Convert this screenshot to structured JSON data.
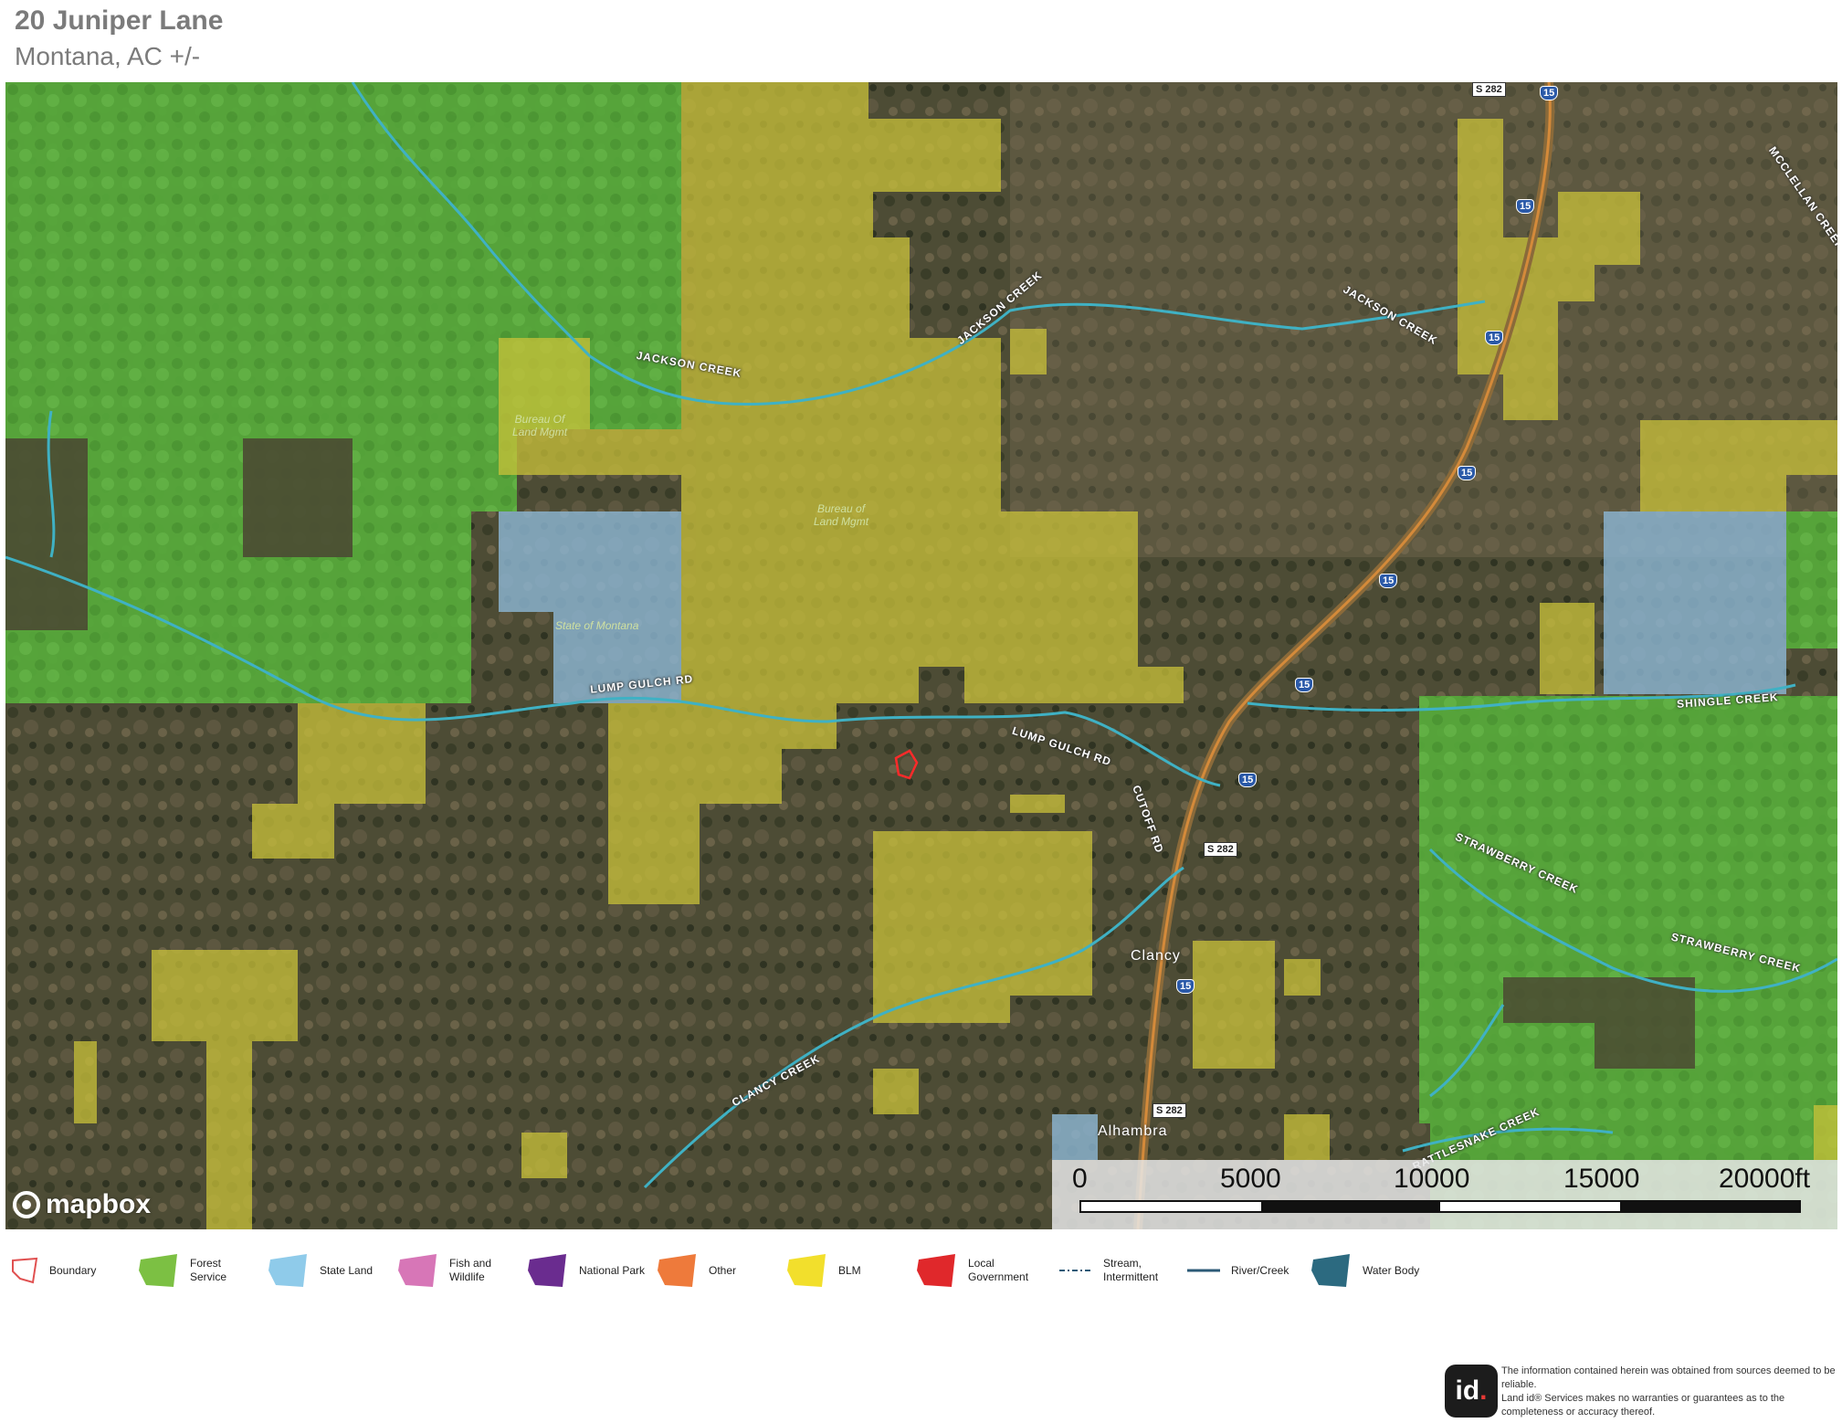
{
  "header": {
    "title": "20 Juniper Lane",
    "subtitle": "Montana,  AC +/-"
  },
  "colors": {
    "forest_service": "#56a83a",
    "blm": "#c9c13a",
    "state_land": "#8db8d6",
    "boundary": "#ff2a2a",
    "river": "#3fb1c4"
  },
  "map": {
    "labels": {
      "jackson_creek_1": "JACKSON CREEK",
      "jackson_creek_2": "JACKSON CREEK",
      "jackson_creek_3": "JACKSON CREEK",
      "mcclellan": "MCCLELLAN CREEK RD",
      "lump_gulch_1": "LUMP GULCH RD",
      "lump_gulch_2": "LUMP GULCH RD",
      "cutoff": "CUTOFF RD",
      "shingle": "SHINGLE CREEK",
      "strawberry_1": "STRAWBERRY CREEK",
      "strawberry_2": "STRAWBERRY CREEK",
      "clancy_creek": "CLANCY CREEK",
      "rattlesnake_1": "RATTLESNAKE CREEK",
      "blm_1": "Bureau Of\nLand Mgmt",
      "blm_2": "Bureau of\nLand Mgmt",
      "state_montana": "State of Montana",
      "clancy": "Clancy",
      "alhambra": "Alhambra",
      "s282": "S 282",
      "i15": "15"
    },
    "attribution": "mapbox",
    "scale": {
      "ticks": [
        "0",
        "5000",
        "10000",
        "15000",
        "20000ft"
      ]
    }
  },
  "legend": [
    {
      "label": "Boundary",
      "icon": "boundary-icon",
      "color": "#e05050"
    },
    {
      "label": "Forest\nService",
      "icon": "forest-service-icon",
      "color": "#7cc043"
    },
    {
      "label": "State Land",
      "icon": "state-land-icon",
      "color": "#8fcbea"
    },
    {
      "label": "Fish and\nWildlife",
      "icon": "fish-wildlife-icon",
      "color": "#d776b7"
    },
    {
      "label": "National Park",
      "icon": "national-park-icon",
      "color": "#6a2c8f"
    },
    {
      "label": "Other",
      "icon": "other-icon",
      "color": "#ee7a3b"
    },
    {
      "label": "BLM",
      "icon": "blm-icon",
      "color": "#f2df2c"
    },
    {
      "label": "Local\nGovernment",
      "icon": "local-government-icon",
      "color": "#e0282b"
    },
    {
      "label": "Stream,\nIntermittent",
      "icon": "stream-intermittent-icon",
      "color": "#2c5a77"
    },
    {
      "label": "River/Creek",
      "icon": "river-creek-icon",
      "color": "#2c5a77"
    },
    {
      "label": "Water Body",
      "icon": "water-body-icon",
      "color": "#2c6a80"
    }
  ],
  "footer": {
    "logo_text": "id",
    "logo_dot": ".",
    "disclaimer": "The information contained herein was obtained from sources deemed to be reliable.\n Land id® Services makes no warranties or guarantees as to the completeness or accuracy thereof."
  }
}
